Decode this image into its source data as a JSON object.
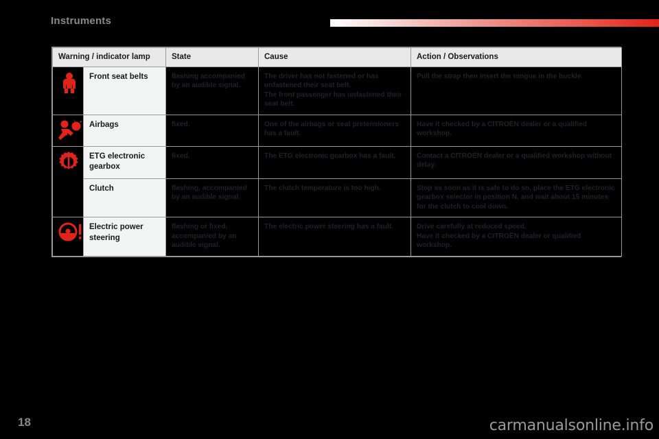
{
  "page": {
    "section_title": "Instruments",
    "page_number": "18",
    "watermark": "carmanualsonline.info",
    "accent_color": "#e2231a",
    "header_bg": "#e9e9e9",
    "lamp_cell_bg": "#f2f3f3",
    "dark_cell_bg": "#000000",
    "dark_cell_text": "#212127"
  },
  "table": {
    "columns": [
      {
        "key": "icon",
        "label": ""
      },
      {
        "key": "lamp",
        "label": "Warning / indicator lamp"
      },
      {
        "key": "state",
        "label": "State"
      },
      {
        "key": "cause",
        "label": "Cause"
      },
      {
        "key": "action",
        "label": "Action / Observations"
      }
    ],
    "rows": [
      {
        "icon": "seat-belt-icon",
        "lamp": "Front seat belts",
        "state": "flashing accompanied by an audible signal.",
        "cause": "The driver has not fastened or has unfastened their seat belt.\nThe front passenger has unfastened their seat belt.",
        "action": "Pull the strap then insert the tongue in the buckle."
      },
      {
        "icon": "airbag-icon",
        "lamp": "Airbags",
        "state": "fixed.",
        "cause": "One of the airbags or seat pretensioners has a fault.",
        "action": "Have it checked by a CITROËN dealer or a qualified workshop."
      },
      {
        "icon": "gearbox-gear-icon",
        "lamp": "ETG electronic gearbox",
        "state": "fixed.",
        "cause": "The ETG electronic gearbox has a fault.",
        "action": "Contact a CITROËN dealer or a qualified workshop without delay."
      },
      {
        "icon": "",
        "lamp": "Clutch",
        "state": "flashing, accompanied by an audible signal.",
        "cause": "The clutch temperature is too high.",
        "action": "Stop as soon as it is safe to do so, place the ETG electronic gearbox selector in position N, and wait about 15 minutes for the clutch to cool down."
      },
      {
        "icon": "steering-wheel-icon",
        "lamp": "Electric power steering",
        "state": "flashing or fixed, accompanied by an audible signal.",
        "cause": "The electric power steering has a fault.",
        "action": "Drive carefully at reduced speed.\nHave it checked by a CITROËN dealer or qualified workshop."
      }
    ]
  }
}
